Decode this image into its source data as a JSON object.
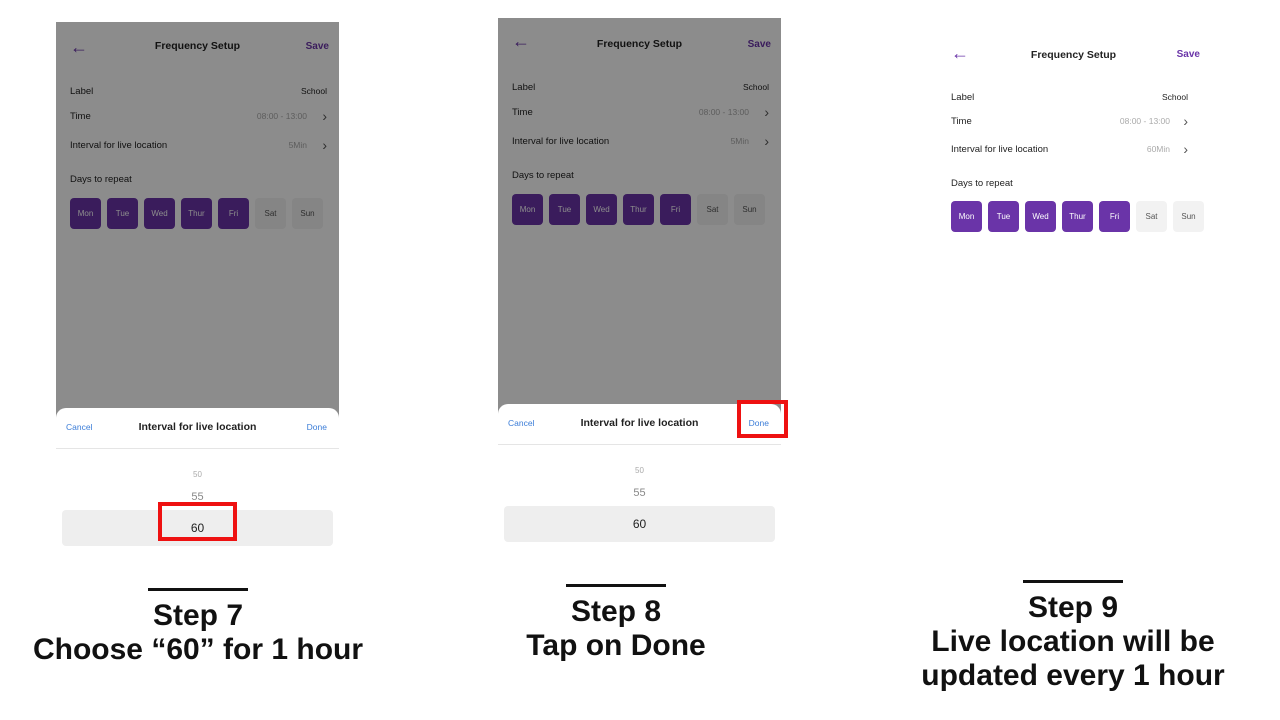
{
  "colors": {
    "purple": "#6a34a8",
    "link_blue": "#3b7dd8",
    "highlight_red": "#ee1111"
  },
  "screen": {
    "back_icon": "arrow-left-icon",
    "back_glyph": "←",
    "title": "Frequency Setup",
    "save_label": "Save",
    "label_name": "Label",
    "label_value": "School",
    "time_name": "Time",
    "time_value": "08:00 - 13:00",
    "interval_name": "Interval for live location",
    "chevron_glyph": "›",
    "days_title": "Days to repeat",
    "days": [
      {
        "label": "Mon",
        "selected": true
      },
      {
        "label": "Tue",
        "selected": true
      },
      {
        "label": "Wed",
        "selected": true
      },
      {
        "label": "Thur",
        "selected": true
      },
      {
        "label": "Fri",
        "selected": true
      },
      {
        "label": "Sat",
        "selected": false
      },
      {
        "label": "Sun",
        "selected": false
      }
    ]
  },
  "panels": [
    {
      "interval_value": "5Min"
    },
    {
      "interval_value": "5Min"
    },
    {
      "interval_value": "60Min"
    }
  ],
  "sheet": {
    "cancel_label": "Cancel",
    "title": "Interval for live location",
    "done_label": "Done",
    "options": [
      "50",
      "55",
      "60"
    ]
  },
  "steps": [
    {
      "step": "Step 7",
      "desc_lines": [
        "Choose “60” for 1 hour"
      ]
    },
    {
      "step": "Step 8",
      "desc_lines": [
        "Tap on Done"
      ]
    },
    {
      "step": "Step 9",
      "desc_lines": [
        "Live location will be",
        "updated every 1 hour"
      ]
    }
  ]
}
